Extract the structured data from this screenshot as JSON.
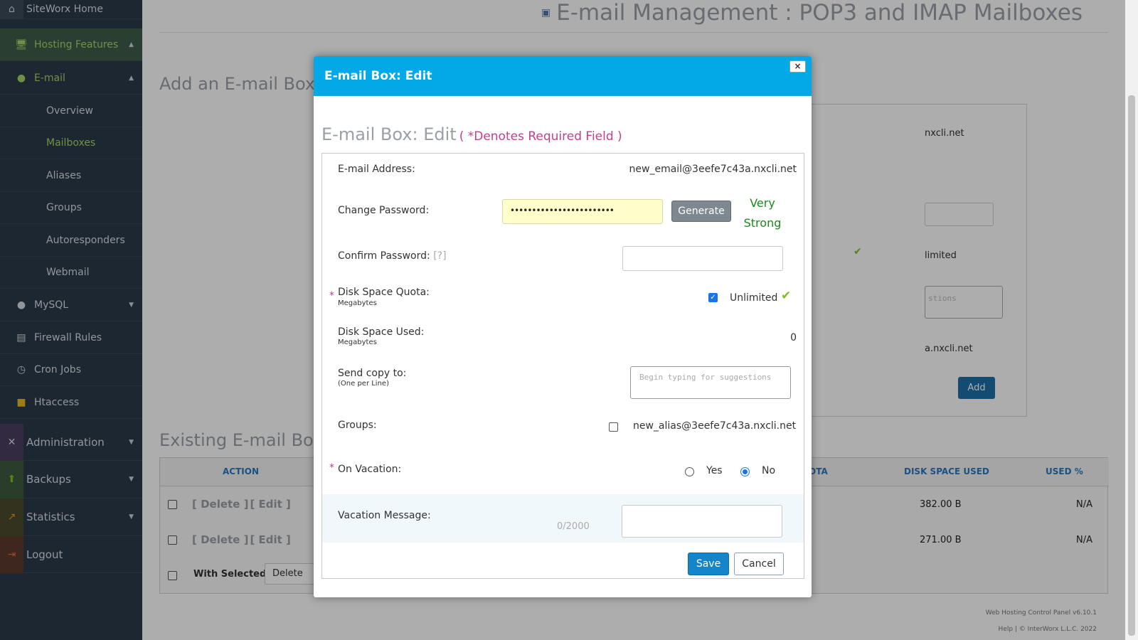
{
  "sidebar": {
    "home": "SiteWorx Home",
    "hosting_features": "Hosting Features",
    "email": "E-mail",
    "sub_items": [
      "Overview",
      "Mailboxes",
      "Aliases",
      "Groups",
      "Autoresponders",
      "Webmail"
    ],
    "mysql": "MySQL",
    "firewall": "Firewall Rules",
    "cron": "Cron Jobs",
    "htaccess": "Htaccess",
    "administration": "Administration",
    "backups": "Backups",
    "statistics": "Statistics",
    "logout": "Logout",
    "active_accent": "#a6d46b"
  },
  "page": {
    "title": "E-mail Management : POP3 and IMAP Mailboxes",
    "add_heading": "Add an E-mail Box",
    "existing_heading": "Existing E-mail Box",
    "bg_domain1": "nxcli.net",
    "bg_unlimited": "limited",
    "bg_textarea": "stions",
    "bg_domain2": "a.nxcli.net",
    "bg_add": "Add",
    "table": {
      "headers": {
        "action": "ACTION",
        "quota": "OTA",
        "disk_used": "DISK SPACE USED",
        "used_pct": "USED %"
      },
      "rows": [
        {
          "delete": "[ Delete ]",
          "edit": "[ Edit ]",
          "disk_used": "382.00 B",
          "used_pct": "N/A"
        },
        {
          "delete": "[ Delete ]",
          "edit": "[ Edit ]",
          "disk_used": "271.00 B",
          "used_pct": "N/A"
        }
      ],
      "with_selected": "With Selected:",
      "bulk_action": "Delete"
    },
    "footer_version": "Web Hosting Control Panel v6.10.1",
    "footer_copy": "Help | © InterWorx L.L.C. 2022"
  },
  "modal": {
    "title": "E-mail Box: Edit",
    "close": "×",
    "form_heading": "E-mail Box: Edit",
    "required_note": "( *Denotes Required Field )",
    "required_star": "*",
    "email_label": "E-mail Address:",
    "email_value": "new_email@3eefe7c43a.nxcli.net",
    "password_label": "Change Password:",
    "password_value": "••••••••••••••••••••••••",
    "generate": "Generate",
    "strength": "Very Strong",
    "strength_color": "#1a8a1a",
    "confirm_label": "Confirm Password:",
    "confirm_help": "[?]",
    "quota_label": "Disk Space Quota:",
    "quota_unit": "Megabytes",
    "quota_unlimited": "Unlimited",
    "used_label": "Disk Space Used:",
    "used_unit": "Megabytes",
    "used_value": "0",
    "sendcopy_label": "Send copy to:",
    "sendcopy_hint": "(One per Line)",
    "sendcopy_placeholder": "Begin typing for suggestions",
    "groups_label": "Groups:",
    "groups_option": "new_alias@3eefe7c43a.nxcli.net",
    "vacation_label": "On Vacation:",
    "vacation_yes": "Yes",
    "vacation_no": "No",
    "message_label": "Vacation Message:",
    "message_counter": "0/2000",
    "save": "Save",
    "cancel": "Cancel",
    "header_color": "#03a9e6"
  }
}
